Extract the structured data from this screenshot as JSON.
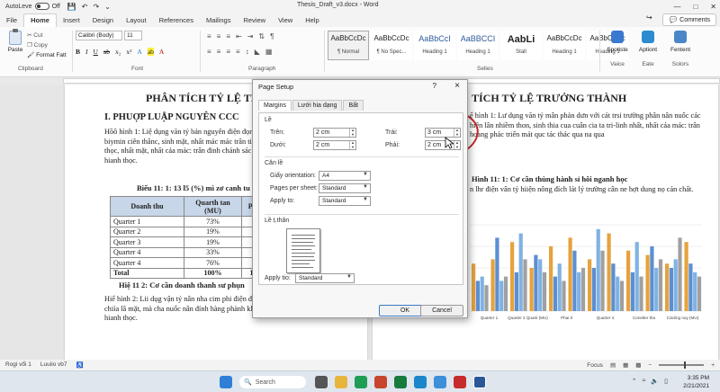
{
  "window": {
    "autosave_label": "AutoLeve",
    "autosave_state": "Off",
    "doc_title": "Thesis_Draft_v3.docx - Word"
  },
  "tabs": [
    "File",
    "Home",
    "Insert",
    "Design",
    "Layout",
    "References",
    "Mailings",
    "Review",
    "View",
    "Help"
  ],
  "active_tab": "Home",
  "comments_label": "Comments",
  "ribbon": {
    "clipboard": {
      "paste": "Paste",
      "cut": "Cut",
      "copy": "Copy",
      "format": "Format Fatt",
      "label": "Clipboard"
    },
    "font": {
      "family": "Calibri (Body)",
      "size": "11",
      "label": "Font"
    },
    "paragraph_label": "Paragraph",
    "styles": [
      {
        "preview": "AaBbCcDc",
        "name": "¶ Normal",
        "kind": "normal"
      },
      {
        "preview": "AaBbCcDc",
        "name": "¶ No Spec...",
        "kind": "normal"
      },
      {
        "preview": "AaBbCcI",
        "name": "Heading 1",
        "kind": "h"
      },
      {
        "preview": "AaBBCCI",
        "name": "Heading 1",
        "kind": "h"
      },
      {
        "preview": "AabLi",
        "name": "Stall",
        "kind": "big"
      },
      {
        "preview": "AaBbCcDc",
        "name": "Heading 1",
        "kind": "normal"
      },
      {
        "preview": "AaBbCcDc",
        "name": "Heading 1",
        "kind": "normal"
      }
    ],
    "styles_label": "Selles",
    "tools": [
      {
        "label": "Spotiste",
        "sub": "Vaice"
      },
      {
        "label": "Aptiont",
        "sub": "Eate"
      },
      {
        "label": "Fentent",
        "sub": "Solors"
      }
    ]
  },
  "doc_left": {
    "title": "PHÂN TÍCH TỶ LỆ TRƯ",
    "heading": "I. PHUỢP LUẬP NGUYÊN CCC",
    "para1": "Hồô hình 1: Liệ dụng văn tỷ bản nguyên điện đọn duóc các biymin ciên thânc, sinh mặt, nhất mác mác trân tinh thất thọc, nhất mặt, nhất cảa mác: trân đinh chánh sác cua chao hianh thọc.",
    "caption1": "Biểu 11: 1: 13 l5 (%) mì zơ canh tu",
    "table_headers": [
      "Doanh thu",
      "Quarth tan (MU)",
      "Phải"
    ],
    "table_rows": [
      [
        "Quarter 1",
        "73%",
        "1"
      ],
      [
        "Quarter 2",
        "19%",
        "2"
      ],
      [
        "Quarter 3",
        "19%",
        "3"
      ],
      [
        "Quarter 4",
        "33%",
        "6"
      ],
      [
        "Quarter 4",
        "76%",
        "7"
      ]
    ],
    "table_total": [
      "Total",
      "100%",
      "100"
    ],
    "caption2": "Hiệ 11 2: Cơ cần doanh thanh sư phụn",
    "para2": "Hiể hình 2: Lii dụg vận tỷ nân nha cim phi điện được các hliymin viện thon, sác chiỉa lâ mặt, mà cha nuốc nân đính hàng phành khả sn các thác mân tha và cha hianh thọc."
  },
  "doc_right": {
    "title": "TÍCH TỶ LỆ TRƯỞNG THÀNH",
    "para1": "ể hình 1: Lư dụng văn tỷ mân phản dưn với cát trsi trường phân nân nuốc các hiên lân nhiềm thon, sinh thia cua cuân cia ta tri-linh nhất, nhất cảa mác: trân hoang phác triển mát quc tác thác qua na qua",
    "caption": "Hình 11: 1: Cơ cần thùng hành sỉ hôi nganh học",
    "para2": "n lhr điện vân tỷ hiiện nông đích lát lý trường cân ne hợt dung nọ cản chất."
  },
  "chart_data": {
    "type": "bar",
    "categories": [
      "Quarter 1",
      "Quarter 2 Quarti (MU)",
      "Phai tỉ",
      "Quarter 4",
      "Conelter tha",
      "Cácling nuy (MU)"
    ],
    "series": [
      {
        "values": [
          55,
          60,
          80,
          50,
          75,
          85,
          60,
          90,
          70,
          65,
          55,
          80
        ]
      },
      {
        "values": [
          35,
          85,
          45,
          65,
          40,
          70,
          50,
          55,
          45,
          75,
          50,
          55
        ]
      },
      {
        "values": [
          40,
          35,
          90,
          60,
          55,
          45,
          95,
          40,
          80,
          50,
          60,
          45
        ]
      },
      {
        "values": [
          30,
          40,
          60,
          45,
          35,
          50,
          70,
          35,
          40,
          60,
          85,
          40
        ]
      }
    ],
    "colors": [
      "#e6a23c",
      "#5b8fd1",
      "#7fb2e5",
      "#a0a0a0"
    ],
    "ylim": [
      0,
      100
    ],
    "grid": true
  },
  "dialog": {
    "title": "Page Setup",
    "help": "?",
    "close": "×",
    "tabs": [
      "Margins",
      "Lưới hia dạng",
      "Bất"
    ],
    "section_margins": "Lề",
    "top_label": "Trên:",
    "top_value": "2 cm",
    "bottom_label": "Dưới:",
    "bottom_value": "2 cm",
    "left_label": "Trái:",
    "left_value": "3 cm",
    "right_label": "Phải:",
    "right_value": "2 cm",
    "section_orientation": "Căn lề",
    "orientation_label": "Giấy orientation:",
    "orientation_value": "A4",
    "pages_label": "Pages per sheet:",
    "pages_value": "Standard",
    "apply_label": "Apply to:",
    "apply_value": "Standard",
    "section_preview": "Lề ṭ.thân",
    "apply2_label": "Apply tio:",
    "apply2_value": "Standard",
    "ok": "OK",
    "cancel": "Cancel"
  },
  "status": {
    "page": "Rogi vổi 1",
    "words": "Luuiio vb7",
    "focus": "Focus"
  },
  "taskbar": {
    "search": "Search",
    "time": "3:35 PM",
    "date": "2/21/2021"
  }
}
